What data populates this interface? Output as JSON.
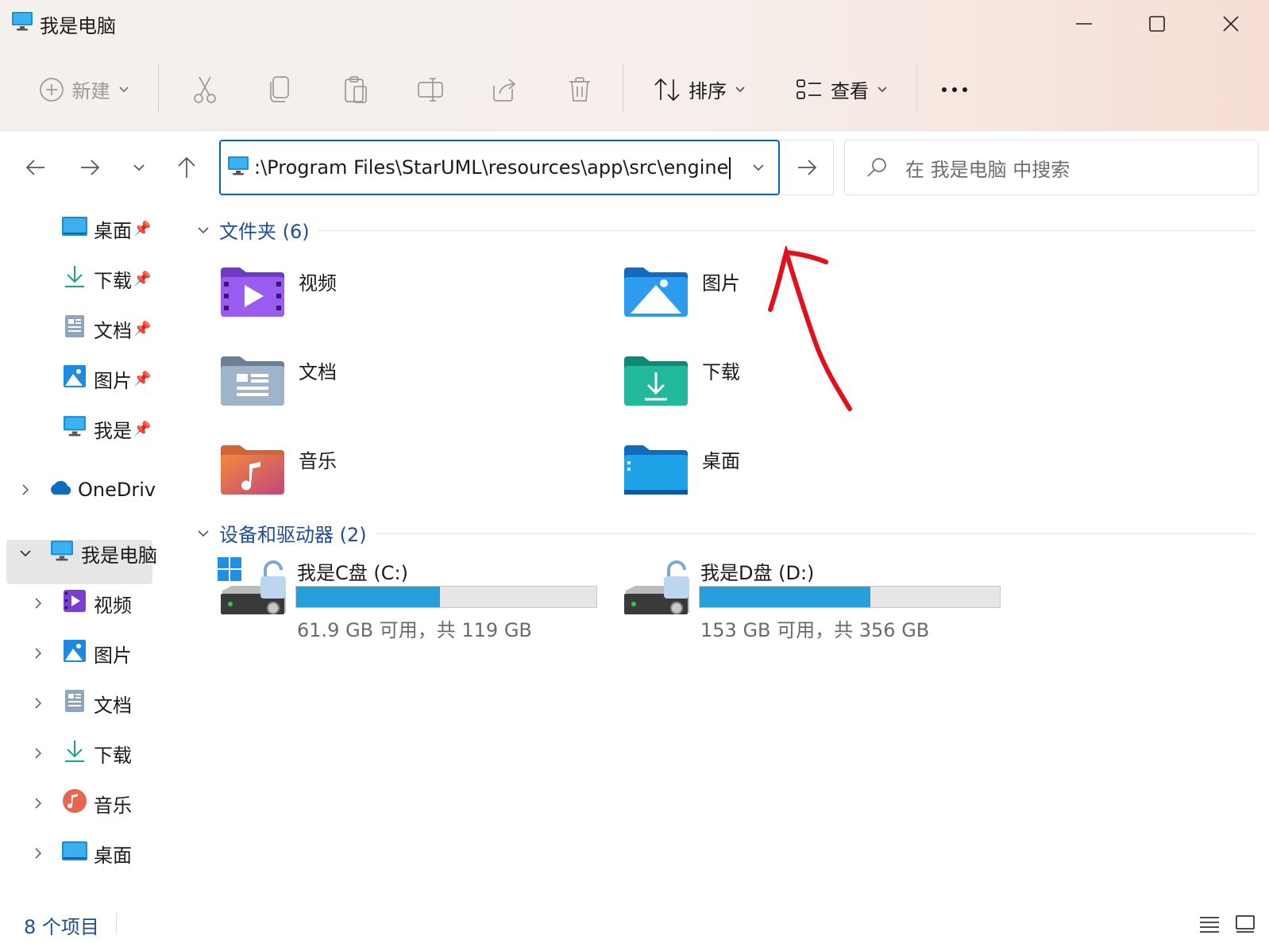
{
  "window": {
    "title": "我是电脑",
    "controls": [
      "minimize-icon",
      "maximize-icon",
      "close-icon"
    ]
  },
  "toolbar": {
    "new_label": "新建",
    "sort_label": "排序",
    "view_label": "查看",
    "more_icon": "more-icon",
    "icons": [
      "cut-icon",
      "copy-icon",
      "paste-icon",
      "rename-icon",
      "share-icon",
      "delete-icon"
    ]
  },
  "address": {
    "path": ":\\Program Files\\StarUML\\resources\\app\\src\\engine"
  },
  "search": {
    "placeholder": "在 我是电脑 中搜索"
  },
  "sidebar": {
    "pinned": [
      {
        "label": "桌面",
        "icon": "desktop-icon"
      },
      {
        "label": "下载",
        "icon": "download-icon"
      },
      {
        "label": "文档",
        "icon": "document-icon"
      },
      {
        "label": "图片",
        "icon": "picture-icon"
      },
      {
        "label": "我是",
        "icon": "computer-icon"
      }
    ],
    "onedrive": "OneDriv",
    "this_pc": "我是电脑",
    "pc_children": [
      {
        "label": "视频",
        "icon": "video-icon"
      },
      {
        "label": "图片",
        "icon": "picture-icon"
      },
      {
        "label": "文档",
        "icon": "document-icon"
      },
      {
        "label": "下载",
        "icon": "download-icon"
      },
      {
        "label": "音乐",
        "icon": "music-icon"
      },
      {
        "label": "桌面",
        "icon": "desktop-icon"
      }
    ]
  },
  "main": {
    "folders_header": "文件夹 (6)",
    "folders": [
      {
        "name": "视频",
        "icon": "video-folder-icon"
      },
      {
        "name": "图片",
        "icon": "picture-folder-icon"
      },
      {
        "name": "文档",
        "icon": "document-folder-icon"
      },
      {
        "name": "下载",
        "icon": "download-folder-icon"
      },
      {
        "name": "音乐",
        "icon": "music-folder-icon"
      },
      {
        "name": "桌面",
        "icon": "desktop-folder-icon"
      }
    ],
    "drives_header": "设备和驱动器 (2)",
    "drives": [
      {
        "name": "我是C盘 (C:)",
        "space": "61.9 GB 可用，共 119 GB",
        "used_fraction": 0.48
      },
      {
        "name": "我是D盘 (D:)",
        "space": "153 GB 可用，共 356 GB",
        "used_fraction": 0.57
      }
    ]
  },
  "status": {
    "item_count": "8 个项目"
  },
  "colors": {
    "accent": "#0067c0",
    "drive_bar": "#26a0da",
    "annotation": "#e3101c"
  }
}
